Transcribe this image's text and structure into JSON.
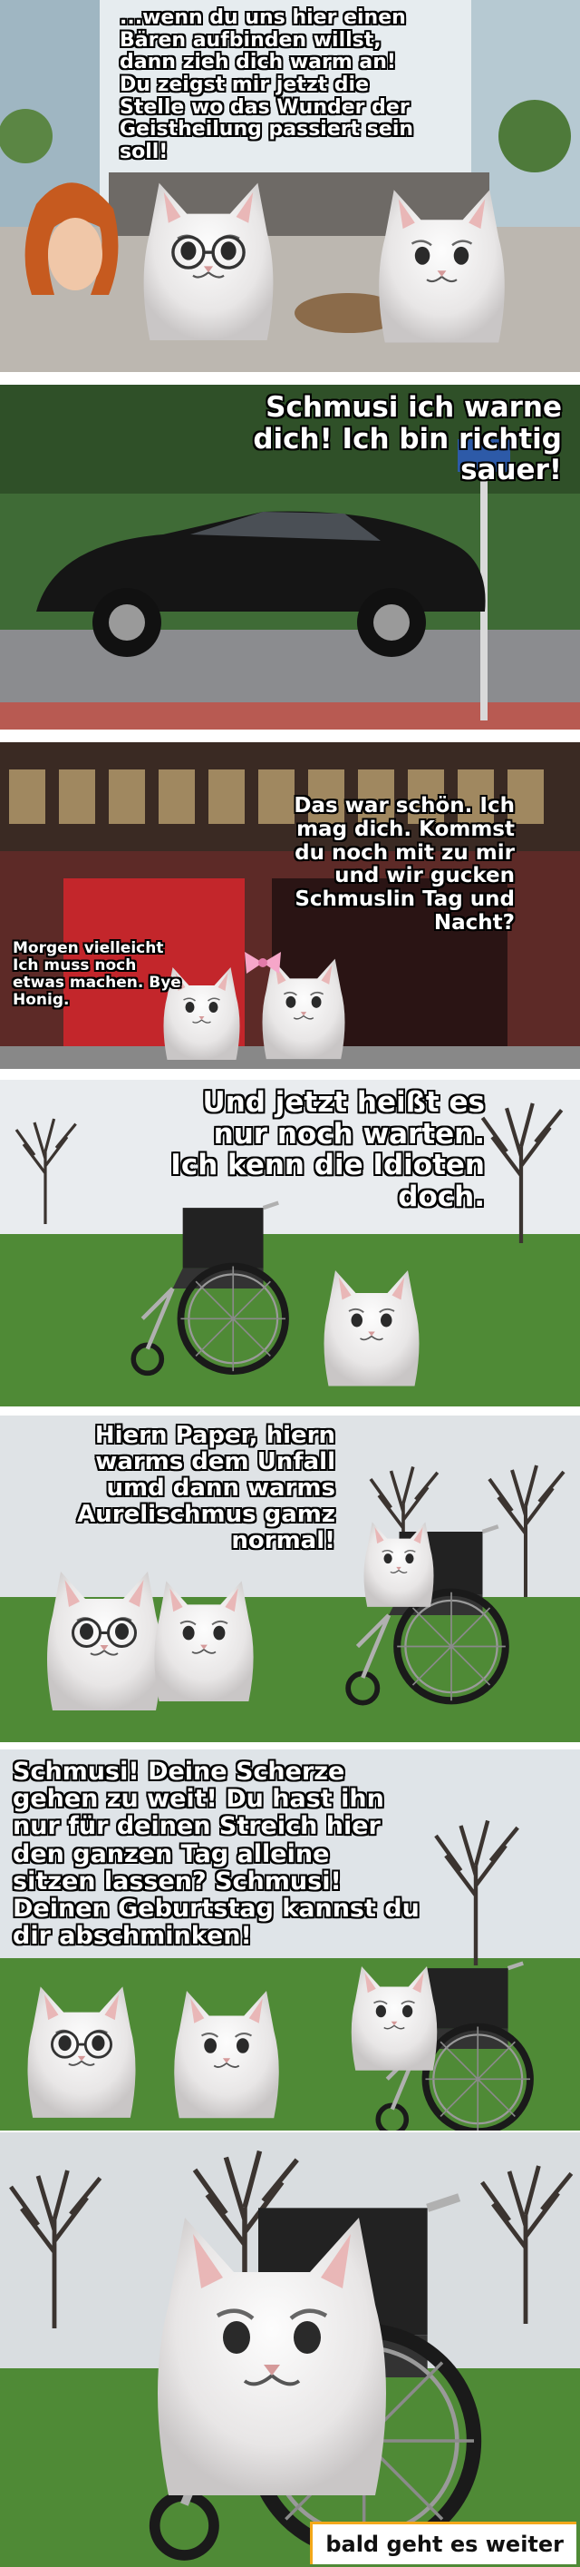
{
  "panels": [
    {
      "caption": "...wenn du uns hier einen\nBären aufbinden willst,\ndann zieh dich warm an!\nDu zeigst mir jetzt die\nStelle wo das Wunder der\nGeistheilung passiert sein\nsoll!"
    },
    {
      "caption": "Schmusi ich warne\ndich! Ich bin richtig\nsauer!"
    },
    {
      "caption": "Das war schön. Ich\nmag dich. Kommst\ndu noch mit zu mir\nund wir gucken\nSchmuslin Tag und\nNacht?",
      "caption2": "Morgen vielleicht\nIch muss noch\netwas machen. Bye\nHonig."
    },
    {
      "caption": "Und jetzt heißt es\nnur noch warten.\nIch kenn die Idioten\ndoch."
    },
    {
      "caption": "Hiern Paper, hiern\nwarms dem Unfall\numd dann warms\nAurelischmus gamz\nnormal!"
    },
    {
      "caption": "Schmusi! Deine Scherze\ngehen zu weit! Du hast ihn\nnur für deinen Streich hier\nden ganzen Tag alleine\nsitzen lassen? Schmusi!\nDeinen Geburtstag kannst du\ndir abschminken!"
    },
    {
      "caption": ""
    }
  ],
  "footer": "bald geht es weiter",
  "colors": {
    "caption_text": "#ffffff",
    "caption_outline": "#000000",
    "footer_border": "#f3a81a"
  }
}
